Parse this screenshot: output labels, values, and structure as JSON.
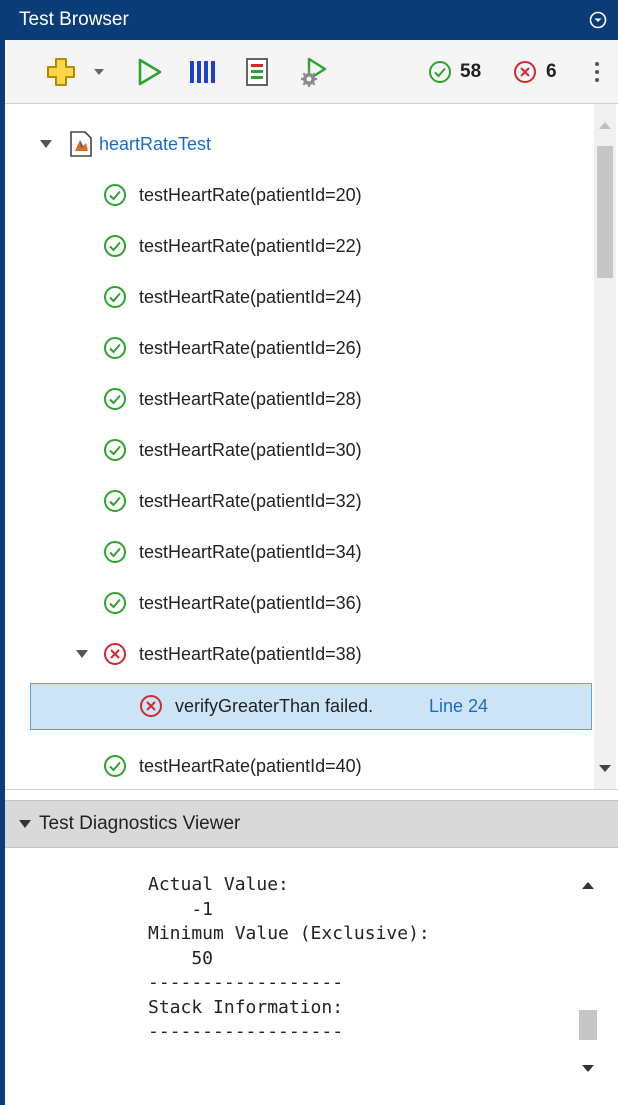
{
  "window": {
    "title": "Test Browser"
  },
  "toolbar": {
    "passed_count": "58",
    "failed_count": "6"
  },
  "tree": {
    "root": {
      "label": "heartRateTest",
      "expanded": true
    },
    "items": [
      {
        "label": "testHeartRate(patientId=20)",
        "status": "passed"
      },
      {
        "label": "testHeartRate(patientId=22)",
        "status": "passed"
      },
      {
        "label": "testHeartRate(patientId=24)",
        "status": "passed"
      },
      {
        "label": "testHeartRate(patientId=26)",
        "status": "passed"
      },
      {
        "label": "testHeartRate(patientId=28)",
        "status": "passed"
      },
      {
        "label": "testHeartRate(patientId=30)",
        "status": "passed"
      },
      {
        "label": "testHeartRate(patientId=32)",
        "status": "passed"
      },
      {
        "label": "testHeartRate(patientId=34)",
        "status": "passed"
      },
      {
        "label": "testHeartRate(patientId=36)",
        "status": "passed"
      },
      {
        "label": "testHeartRate(patientId=38)",
        "status": "failed",
        "expanded": true
      },
      {
        "label": "testHeartRate(patientId=40)",
        "status": "passed"
      }
    ],
    "failure": {
      "label": "verifyGreaterThan failed.",
      "link": "Line 24",
      "selected": true
    }
  },
  "diagnostics": {
    "header": "Test Diagnostics Viewer",
    "lines": [
      "Actual Value:",
      "    -1",
      "Minimum Value (Exclusive):",
      "    50",
      "------------------",
      "Stack Information:",
      "------------------"
    ]
  },
  "colors": {
    "title_bar": "#0a3d78",
    "pass_green": "#2ea32e",
    "fail_red": "#d6262f",
    "link_blue": "#1a6dc4",
    "selection": "#cde4f7"
  }
}
